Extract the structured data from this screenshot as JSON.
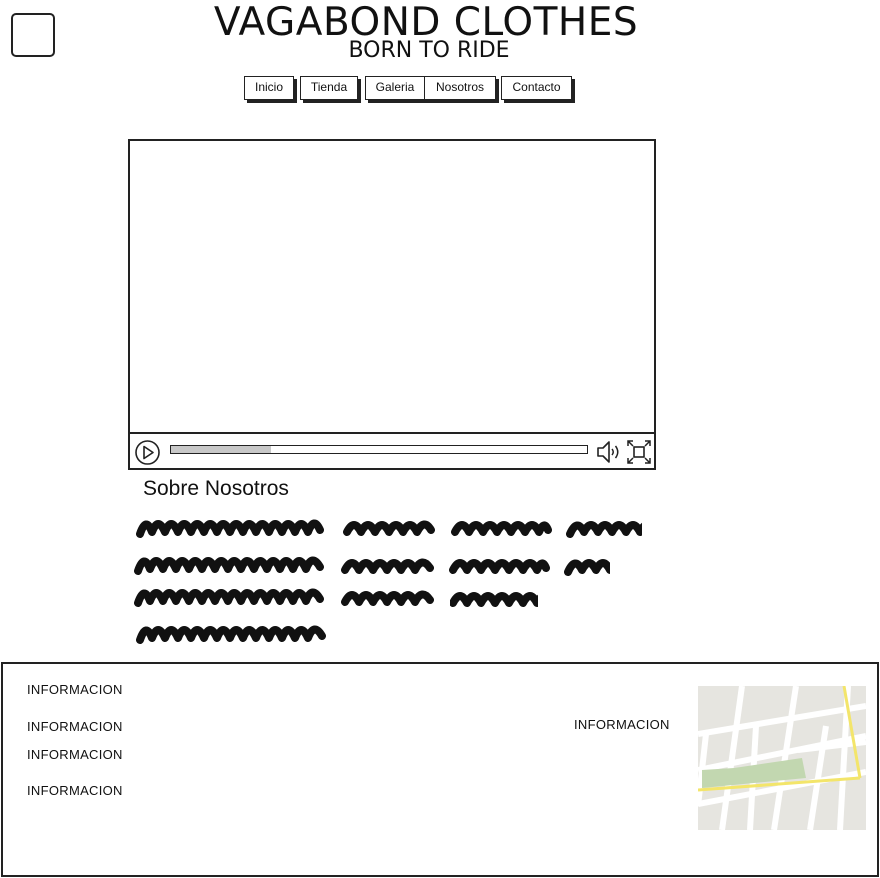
{
  "header": {
    "logo_icon": "placeholder-square-icon",
    "title": "VAGABOND CLOTHES",
    "tagline": "BORN TO RIDE"
  },
  "nav": {
    "items": [
      {
        "label": "Inicio"
      },
      {
        "label": "Tienda"
      },
      {
        "label": "Galeria"
      },
      {
        "label": "Nosotros"
      },
      {
        "label": "Contacto"
      }
    ]
  },
  "video": {
    "play_icon": "play-icon",
    "volume_icon": "volume-icon",
    "fullscreen_icon": "fullscreen-icon",
    "progress": 0.24
  },
  "about": {
    "heading": "Sobre Nosotros"
  },
  "footer": {
    "info_items": [
      "INFORMACION",
      "INFORMACION",
      "INFORMACION",
      "INFORMACION"
    ],
    "info_right": "INFORMACION",
    "map_icon": "map-icon"
  },
  "colors": {
    "stroke": "#222222",
    "progress_fill": "#c8c8c8",
    "map_land": "#e6e5e0",
    "map_park": "#c2d7b0",
    "map_highway": "#f3e56a"
  }
}
